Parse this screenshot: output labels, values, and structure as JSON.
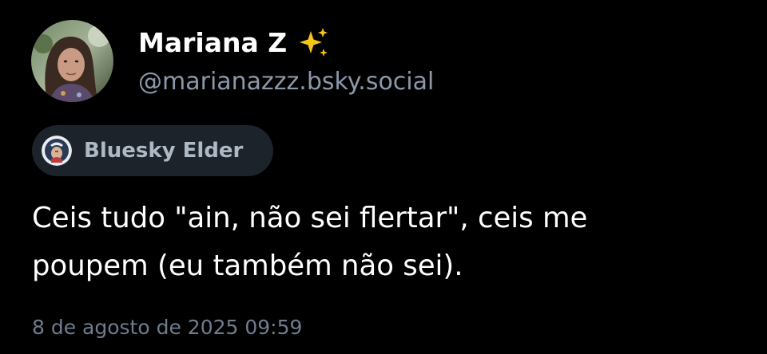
{
  "author": {
    "display_name": "Mariana Z",
    "handle": "@marianazzz.bsky.social",
    "name_emoji_icon": "sparkles-icon",
    "avatar_icon": "profile-photo-avatar"
  },
  "badge": {
    "label": "Bluesky Elder",
    "icon": "bluesky-elder-badge-icon"
  },
  "post": {
    "text_line_1": "Ceis tudo \"ain, não sei flertar\", ceis me",
    "text_line_2": "poupem (eu também não sei).",
    "timestamp": "8 de agosto de 2025 09:59"
  },
  "colors": {
    "background": "#000000",
    "text_primary": "#ffffff",
    "text_secondary": "#8b98a9",
    "badge_background": "#1d232b",
    "badge_text": "#aeb9c6",
    "timestamp": "#6f7d8f",
    "sparkle": "#f5c518"
  }
}
